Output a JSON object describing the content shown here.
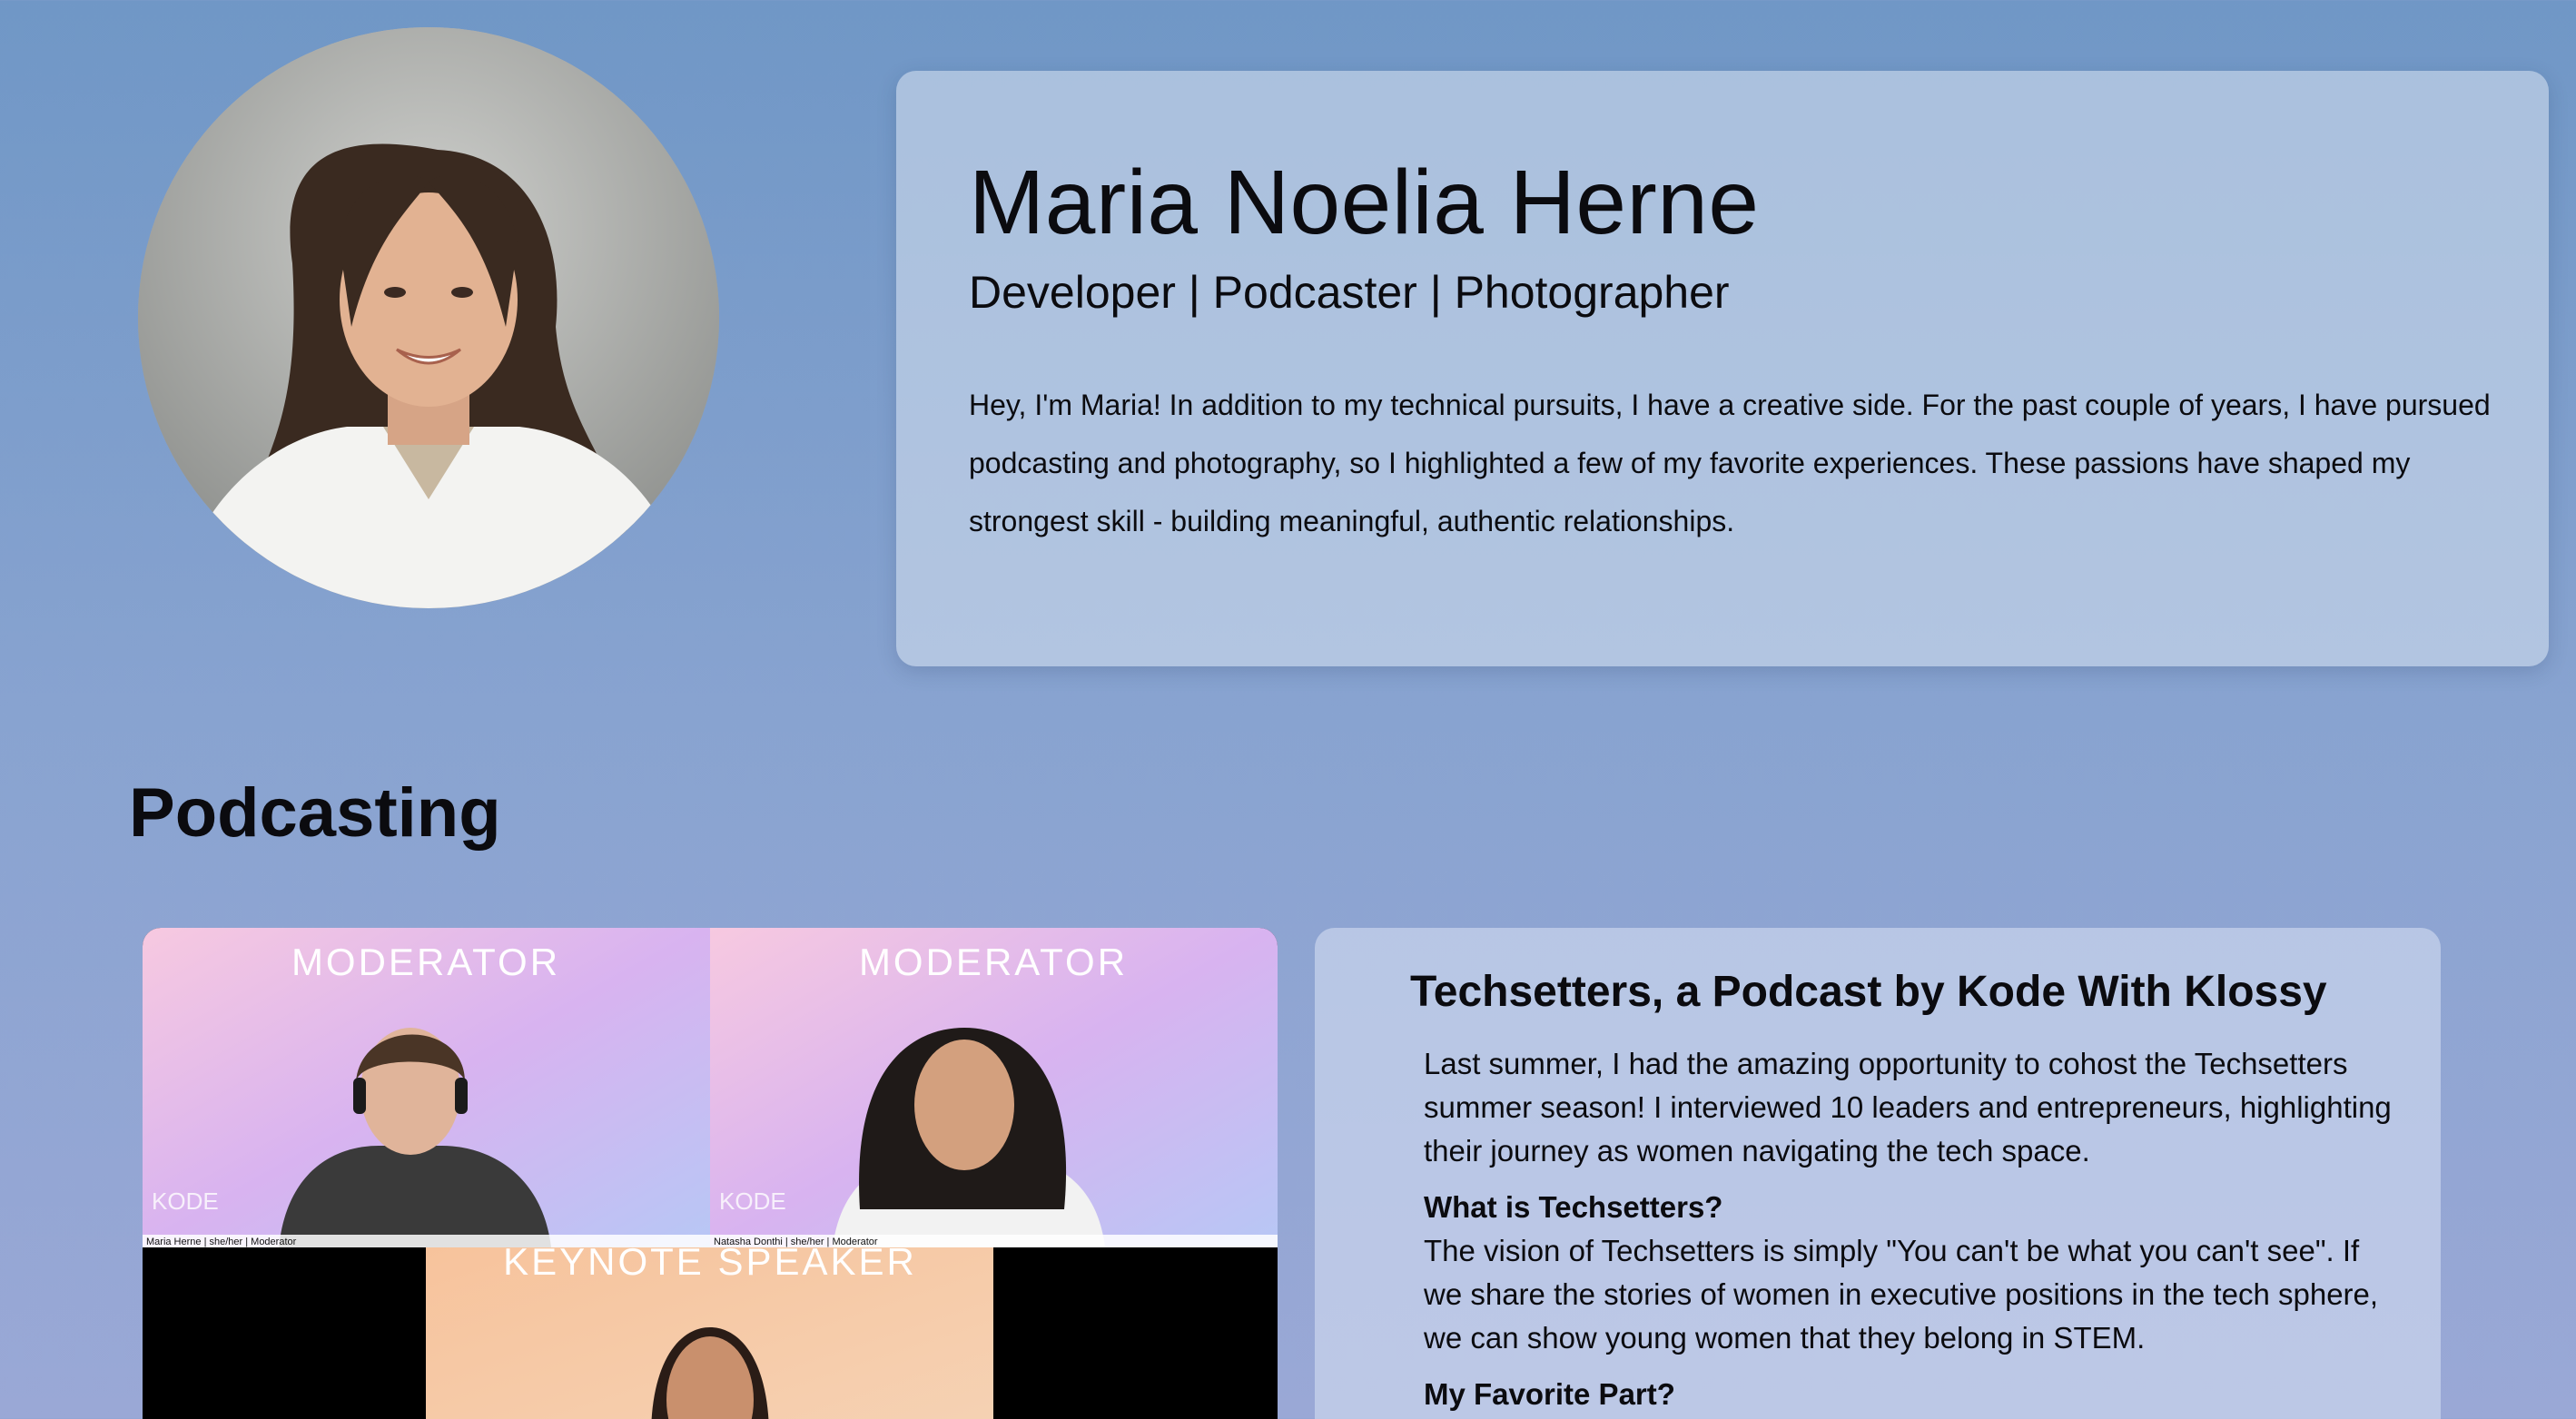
{
  "profile": {
    "name": "Maria Noelia Herne",
    "roles": "Developer | Podcaster | Photographer",
    "bio": "Hey, I'm Maria! In addition to my technical pursuits, I have a creative side. For the past couple of years, I have pursued podcasting and photography, so I highlighted a few of my favorite experiences. These passions have shaped my strongest skill - building meaningful, authentic relationships."
  },
  "podcasting": {
    "section_title": "Podcasting",
    "media": {
      "tile1_label": "MODERATOR",
      "tile1_caption": "Maria Herne | she/her | Moderator",
      "tile2_label": "MODERATOR",
      "tile2_caption": "Natasha Donthi | she/her | Moderator",
      "tile3_label": "KEYNOTE SPEAKER",
      "watermark": "KODE"
    },
    "card": {
      "title": "Techsetters, a Podcast by Kode With Klossy",
      "intro": "Last summer, I had the amazing opportunity to cohost the Techsetters summer season! I interviewed 10 leaders and entrepreneurs, highlighting their journey as women navigating the tech space.",
      "q1": "What is Techsetters?",
      "a1": "The vision of Techsetters is simply \"You can't be what you can't see\". If we share the stories of women in executive positions in the tech sphere, we can show young women that they belong in STEM.",
      "q2": "My Favorite Part?"
    }
  },
  "colors": {
    "background_top": "#7097c6",
    "background_bottom": "#9aa8d6",
    "card": "#cddaec",
    "text": "#0b0b0f"
  }
}
